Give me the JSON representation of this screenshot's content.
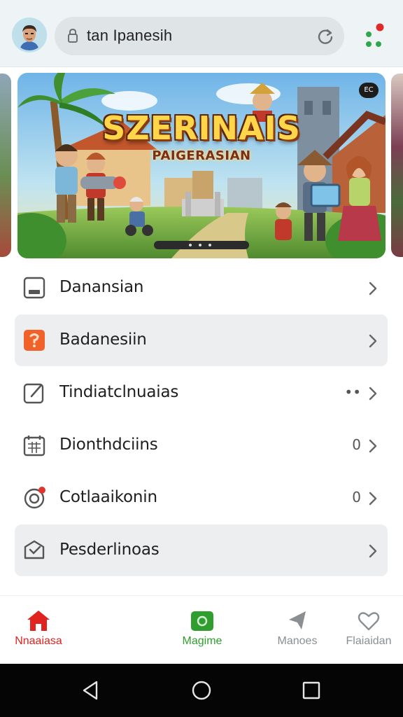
{
  "browser": {
    "url_text": "tan Ipanesih",
    "avatar_icon": "user-avatar",
    "lock_icon": "lock-icon",
    "reload_icon": "reload-icon",
    "menu_icon": "color-dots-menu-icon"
  },
  "banner": {
    "title": "SZERINAIS",
    "subtitle": "PAIGERASIAN",
    "badge": "EC"
  },
  "list": {
    "items": [
      {
        "label": "Danansian",
        "icon": "image-frame-icon",
        "count": ""
      },
      {
        "label": "Badanesiin",
        "icon": "orange-app-icon",
        "count": ""
      },
      {
        "label": "Tindiatclnuaias",
        "icon": "edit-box-icon",
        "count": "••"
      },
      {
        "label": "Dionthdciins",
        "icon": "calendar-grid-icon",
        "count": "0"
      },
      {
        "label": "Cotlaaikonin",
        "icon": "target-notification-icon",
        "count": "0"
      },
      {
        "label": "Pesderlinoas",
        "icon": "package-box-icon",
        "count": ""
      }
    ]
  },
  "bottom_nav": {
    "items": [
      {
        "label": "Nnaaiasa",
        "icon": "home-icon",
        "color": "#e0231f"
      },
      {
        "label": "Magime",
        "icon": "camera-icon",
        "color": "#2f9e2f"
      },
      {
        "label": "Manoes",
        "icon": "star-icon",
        "color": "#8a8f94"
      },
      {
        "label": "Flaiaidan",
        "icon": "heart-icon",
        "color": "#8a8f94"
      }
    ]
  },
  "colors": {
    "home_red": "#e0231f",
    "active_green": "#2f9e2f",
    "inactive_grey": "#8a8f94",
    "row_highlight": "#eceeef"
  }
}
